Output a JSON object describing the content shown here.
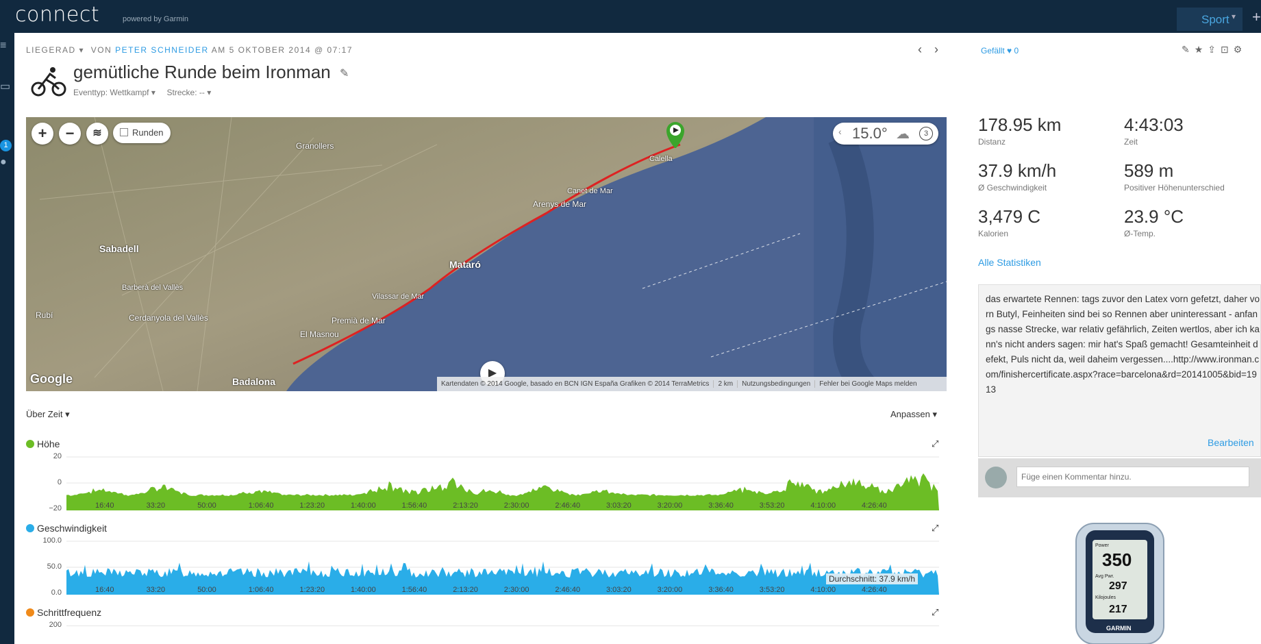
{
  "header": {
    "logo": "connect",
    "logo_sub": "powered by Garmin",
    "sport_label": "Sport"
  },
  "leftnav": {
    "badge": "1"
  },
  "activity": {
    "type_label": "LIEGERAD",
    "by_label": "VON",
    "author": "PETER SCHNEIDER",
    "date_text": "AM 5 OKTOBER 2014 @ 07:17",
    "title": "gemütliche Runde beim Ironman",
    "event_type": "Eventtyp: Wettkampf",
    "route": "Strecke: --"
  },
  "map": {
    "runden_label": "Runden",
    "temperature": "15.0°",
    "weather_count": "3",
    "google_label": "Google",
    "footer": {
      "data": "Kartendaten © 2014 Google, basado en BCN IGN España Grafiken © 2014 TerraMetrics",
      "scale": "2 km",
      "terms": "Nutzungsbedingungen",
      "report": "Fehler bei Google Maps melden"
    },
    "place_labels": [
      "Mataró",
      "Sabadell",
      "Granollers",
      "Badalona",
      "Arenys de Mar",
      "Canet de Mar",
      "Calella",
      "Cerdanyola del Vallès",
      "Premià de Mar",
      "El Masnou",
      "Vilassar de Mar",
      "Rubí",
      "Barberà del Vallès"
    ]
  },
  "controls": {
    "over_time": "Über Zeit",
    "customize": "Anpassen"
  },
  "charts": [
    {
      "label": "Höhe",
      "color": "#6cbd25",
      "ticks": [
        "20",
        "0",
        "−20"
      ]
    },
    {
      "label": "Geschwindigkeit",
      "color": "#2aade8",
      "ticks": [
        "100.0",
        "50.0",
        "0.0"
      ],
      "average": "Durchschnitt: 37.9 km/h"
    },
    {
      "label": "Schrittfrequenz",
      "color": "#f08a1a",
      "ticks": [
        "200"
      ]
    }
  ],
  "time_axis": [
    "16:40",
    "33:20",
    "50:00",
    "1:06:40",
    "1:23:20",
    "1:40:00",
    "1:56:40",
    "2:13:20",
    "2:30:00",
    "2:46:40",
    "3:03:20",
    "3:20:00",
    "3:36:40",
    "3:53:20",
    "4:10:00",
    "4:26:40"
  ],
  "social": {
    "likes_label": "Gefällt",
    "likes_count": "0"
  },
  "stats": [
    {
      "value": "178.95 km",
      "label": "Distanz"
    },
    {
      "value": "4:43:03",
      "label": "Zeit"
    },
    {
      "value": "37.9 km/h",
      "label": "Ø Geschwindigkeit"
    },
    {
      "value": "589 m",
      "label": "Positiver Höhenunterschied"
    },
    {
      "value": "3,479 C",
      "label": "Kalorien"
    },
    {
      "value": "23.9 °C",
      "label": "Ø-Temp."
    }
  ],
  "all_stats_link": "Alle Statistiken",
  "notes": {
    "text": "das erwartete Rennen: tags zuvor den Latex vorn gefetzt, daher vorn Butyl, Feinheiten sind bei so Rennen aber uninteressant - anfangs nasse Strecke, war relativ gefährlich, Zeiten wertlos, aber ich kann's nicht anders sagen: mir hat's Spaß gemacht! Gesamteinheit defekt, Puls nicht da, weil daheim vergessen....http://www.ironman.com/finishercertificate.aspx?race=barcelona&rd=20141005&bid=1913",
    "edit_label": "Bearbeiten"
  },
  "comment": {
    "placeholder": "Füge einen Kommentar hinzu."
  },
  "device": {
    "power": "350",
    "avg_pwr": "297",
    "kilojoules": "217",
    "brand": "GARMIN",
    "l1": "Power",
    "l2": "Avg Pwr.",
    "l3": "Kilojoules"
  }
}
